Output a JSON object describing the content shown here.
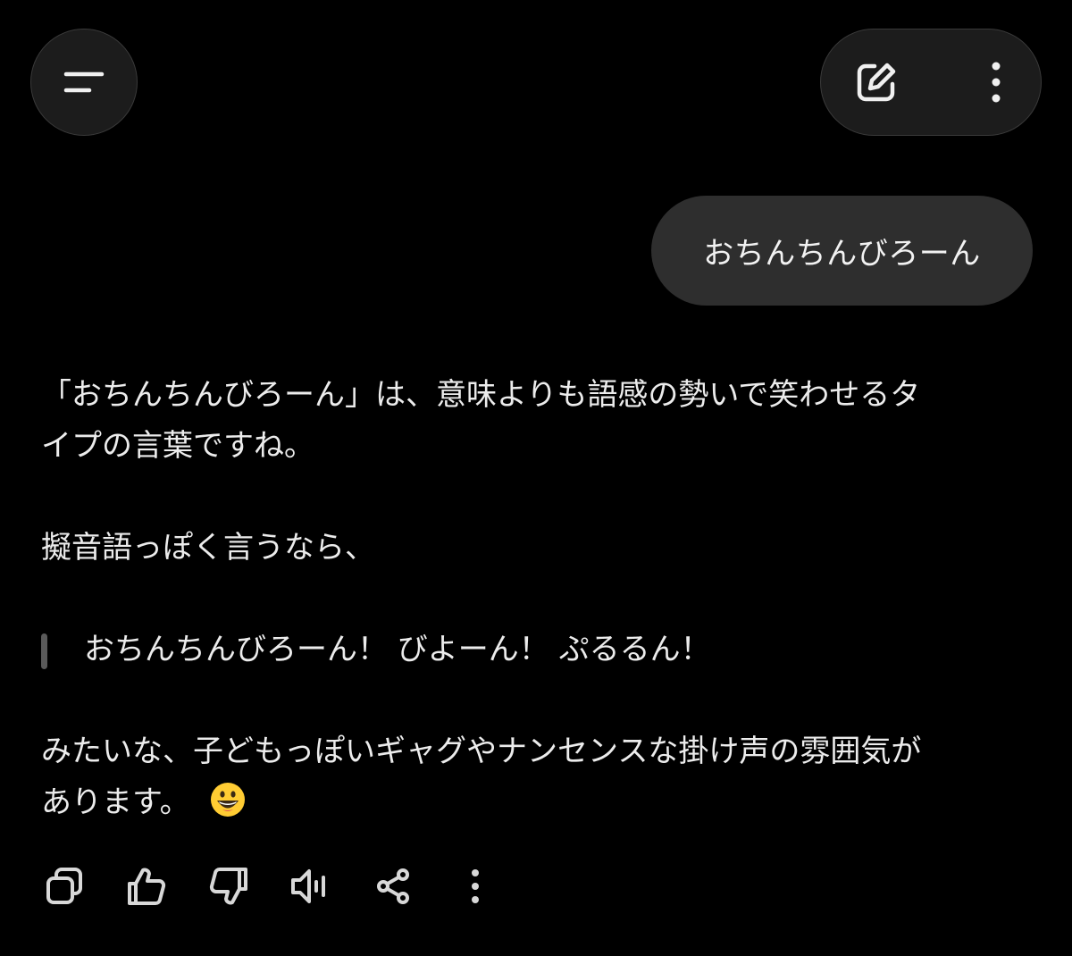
{
  "header": {
    "menu_icon": "menu-icon",
    "new_chat_icon": "edit-icon",
    "more_icon": "more-vertical-icon"
  },
  "user_message": {
    "text": "おちんちんびろーん"
  },
  "assistant_message": {
    "paragraph1_line1": "「おちんちんびろーん」は、意味よりも語感の勢いで笑わせるタ",
    "paragraph1_line2": "イプの言葉ですね。",
    "paragraph2": "擬音語っぽく言うなら、",
    "quote": "おちんちんびろーん！ びよーん！ ぷるるん！",
    "paragraph3_line1": "みたいな、子どもっぽいギャグやナンセンスな掛け声の雰囲気が",
    "paragraph3_line2": "あります。",
    "emoji": "grinning-face-emoji"
  },
  "toolbar": {
    "items": [
      "copy-icon",
      "thumbs-up-icon",
      "thumbs-down-icon",
      "speaker-icon",
      "share-icon",
      "more-vertical-icon"
    ]
  },
  "colors": {
    "background": "#000000",
    "button_bg": "#1c1c1c",
    "bubble_bg": "#2e2e2e",
    "text": "#ececec",
    "icon": "#d8d8d8"
  }
}
